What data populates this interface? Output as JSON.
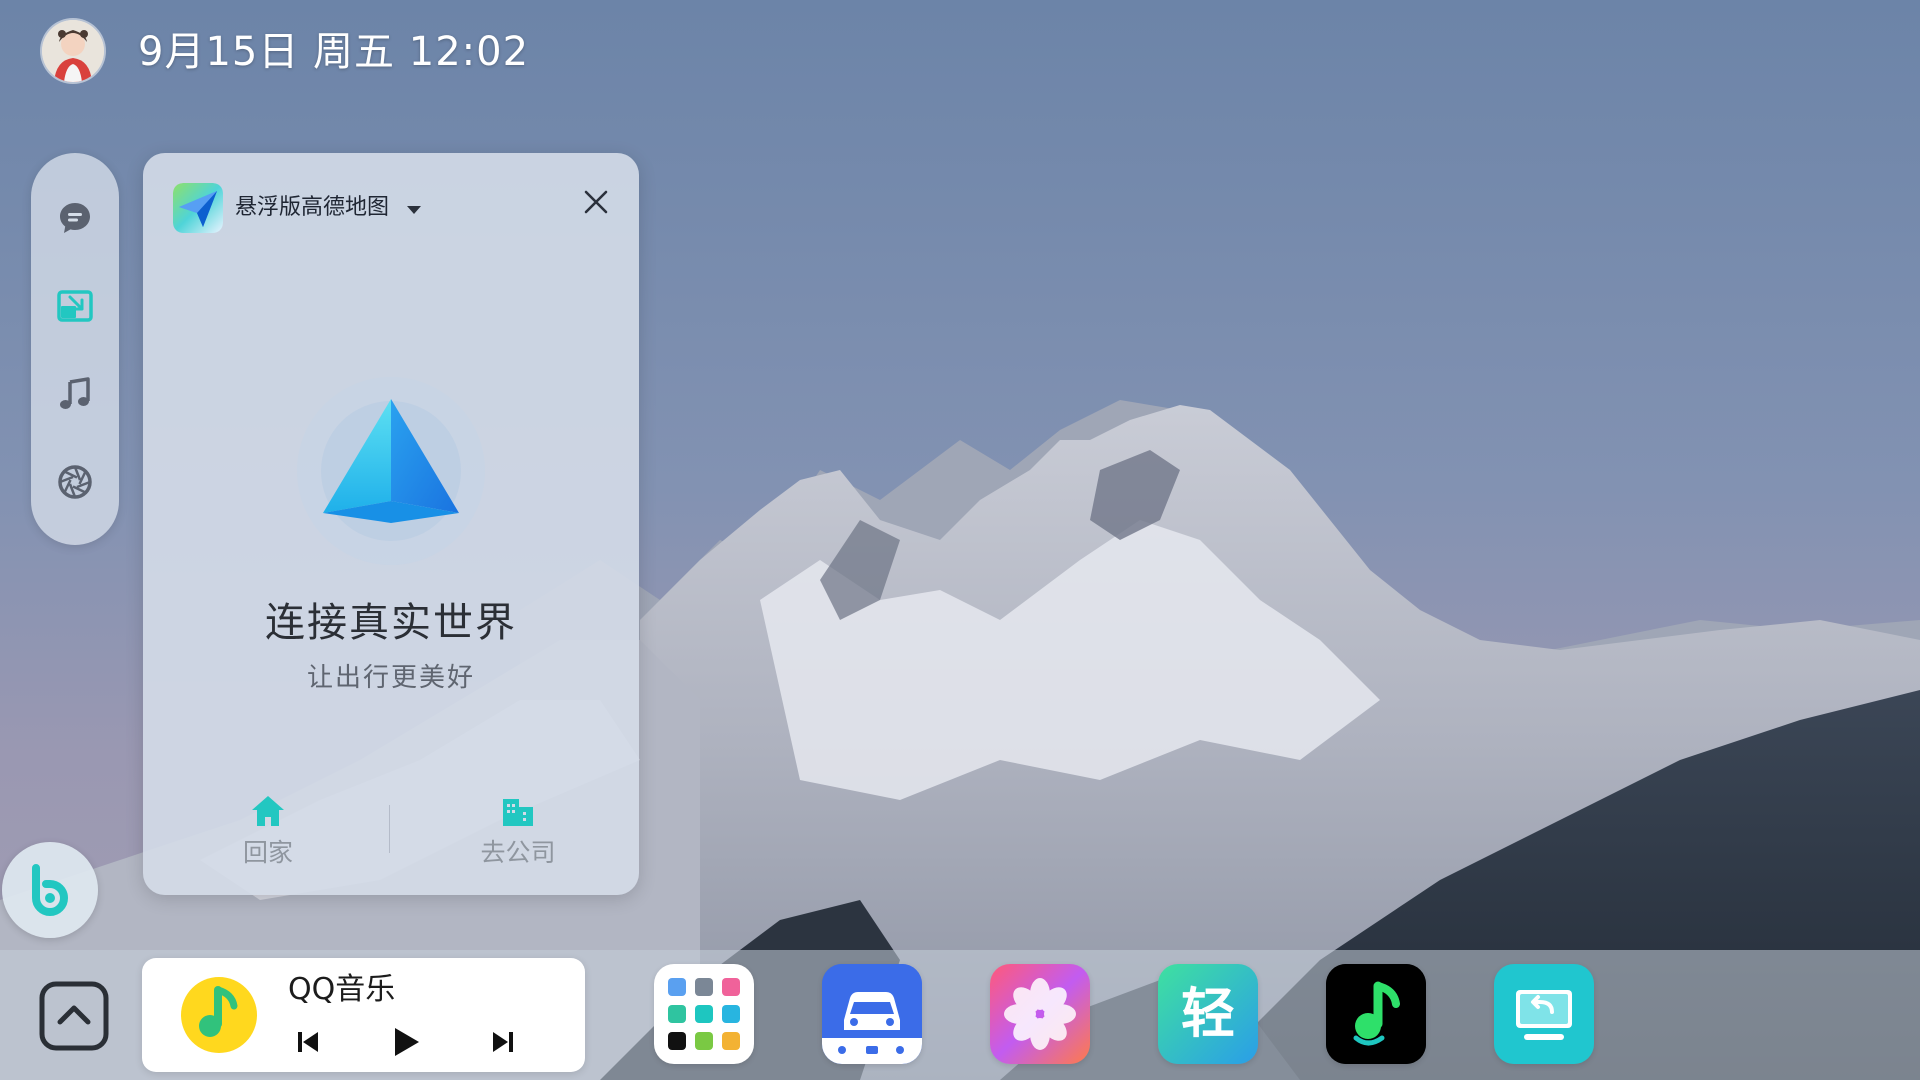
{
  "status_bar": {
    "datetime": "9月15日 周五 12:02"
  },
  "side_rail": {
    "items": [
      {
        "icon": "chat-icon"
      },
      {
        "icon": "pip-window-icon",
        "active": true
      },
      {
        "icon": "music-note-icon"
      },
      {
        "icon": "aperture-icon"
      }
    ]
  },
  "map_window": {
    "app_name": "悬浮版高德地图",
    "slogan": "连接真实世界",
    "sub_slogan": "让出行更美好",
    "actions": [
      {
        "label": "回家",
        "icon": "home-icon"
      },
      {
        "label": "去公司",
        "icon": "office-building-icon"
      }
    ]
  },
  "music_card": {
    "app_name": "QQ音乐"
  },
  "dock": {
    "apps": [
      {
        "icon": "app-grid-icon"
      },
      {
        "icon": "car-icon"
      },
      {
        "icon": "photos-icon"
      },
      {
        "icon": "qing-app-icon",
        "text": "轻"
      },
      {
        "icon": "music-app-icon"
      },
      {
        "icon": "screen-cast-icon"
      }
    ]
  },
  "colors": {
    "accent_teal": "#22c7c1",
    "icon_gray": "#6b7280"
  }
}
